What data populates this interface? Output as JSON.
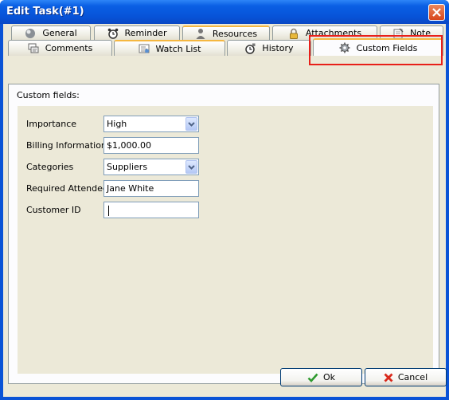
{
  "window": {
    "title": "Edit Task(#1)"
  },
  "tabs_top": [
    {
      "label": "General",
      "icon": "globe-icon"
    },
    {
      "label": "Reminder",
      "icon": "alarm-clock-icon"
    },
    {
      "label": "Resources",
      "icon": "person-icon"
    },
    {
      "label": "Attachments",
      "icon": "padlock-icon"
    },
    {
      "label": "Note",
      "icon": "note-icon"
    }
  ],
  "tabs_bottom": [
    {
      "label": "Comments",
      "icon": "comments-icon"
    },
    {
      "label": "Watch List",
      "icon": "watch-list-icon"
    },
    {
      "label": "History",
      "icon": "history-icon"
    },
    {
      "label": "Custom Fields",
      "icon": "gear-icon",
      "selected": true
    }
  ],
  "panel": {
    "title": "Custom fields:"
  },
  "fields": [
    {
      "label": "Importance",
      "value": "High",
      "type": "combo"
    },
    {
      "label": "Billing Information",
      "value": "$1,000.00",
      "type": "text"
    },
    {
      "label": "Categories",
      "value": "Suppliers",
      "type": "combo"
    },
    {
      "label": "Required Attendee",
      "value": "Jane White",
      "type": "text"
    },
    {
      "label": "Customer ID",
      "value": "",
      "type": "text",
      "focused": true
    }
  ],
  "buttons": {
    "ok": "Ok",
    "cancel": "Cancel"
  },
  "colors": {
    "title_bar": "#0a5fe4",
    "dialog_bg": "#ece9d8",
    "highlight": "#e8201a",
    "tab_accent": "#f5b740"
  }
}
